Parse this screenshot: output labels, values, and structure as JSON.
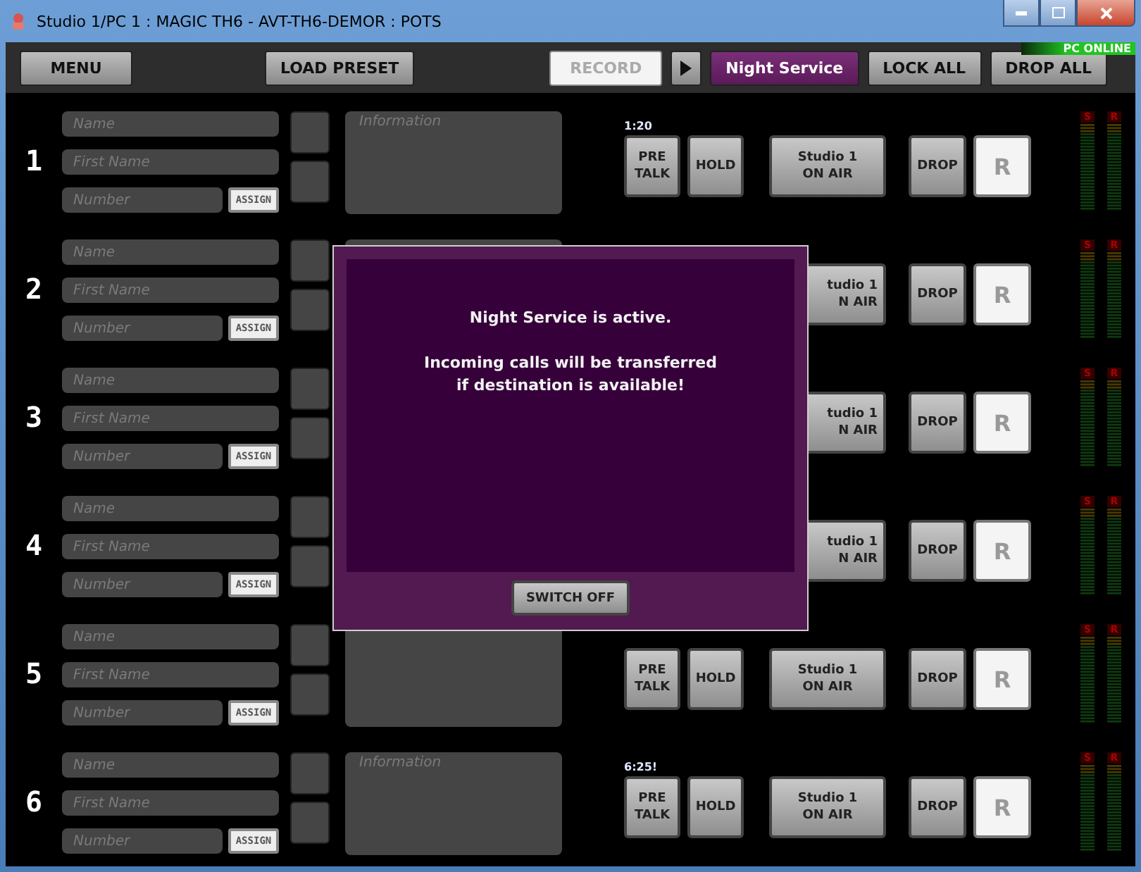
{
  "window": {
    "title": "Studio 1/PC 1 : MAGIC TH6 - AVT-TH6-DEMOR : POTS"
  },
  "toolbar": {
    "groups": [
      [
        {
          "kind": "text",
          "label": "MENU",
          "disabled": false,
          "on": false
        }
      ],
      [
        {
          "kind": "text",
          "label": "LOAD PRESET",
          "disabled": false,
          "on": false
        }
      ],
      [
        {
          "kind": "text",
          "label": "RECORD",
          "disabled": true,
          "on": false
        },
        {
          "kind": "play"
        },
        {
          "kind": "text",
          "label": "Night Service",
          "disabled": false,
          "on": true
        },
        {
          "kind": "text",
          "label": "LOCK ALL",
          "disabled": false,
          "on": false
        },
        {
          "kind": "text",
          "label": "DROP ALL",
          "disabled": false,
          "on": false
        }
      ]
    ]
  },
  "status": {
    "label": "PC ONLINE",
    "online": true
  },
  "lines": [
    {
      "kind": "full",
      "number": "1",
      "name_placeholder": "Name",
      "first_name_placeholder": "First Name",
      "number_placeholder": "Number",
      "assign": "ASSIGN",
      "info_placeholder": "Information",
      "timer": "1:20",
      "pre_talk": "PRE\nTALK",
      "hold": "HOLD",
      "on_air": "Studio 1\nON AIR",
      "drop": "DROP",
      "r": "R",
      "meter_labels": [
        "S",
        "R"
      ]
    },
    {
      "kind": "covered",
      "number": "2",
      "name_placeholder": "Name",
      "first_name_placeholder": "First Name",
      "number_placeholder": "Number",
      "assign": "ASSIGN",
      "on_air": "tudio 1\nN AIR",
      "drop": "DROP",
      "r": "R",
      "meter_labels": [
        "S",
        "R"
      ]
    },
    {
      "kind": "covered",
      "number": "3",
      "name_placeholder": "Name",
      "first_name_placeholder": "First Name",
      "number_placeholder": "Number",
      "assign": "ASSIGN",
      "on_air": "tudio 1\nN AIR",
      "drop": "DROP",
      "r": "R",
      "meter_labels": [
        "S",
        "R"
      ]
    },
    {
      "kind": "covered",
      "number": "4",
      "name_placeholder": "Name",
      "first_name_placeholder": "First Name",
      "number_placeholder": "Number",
      "assign": "ASSIGN",
      "on_air": "tudio 1\nN AIR",
      "drop": "DROP",
      "r": "R",
      "meter_labels": [
        "S",
        "R"
      ]
    },
    {
      "kind": "full",
      "number": "5",
      "name_placeholder": "Name",
      "first_name_placeholder": "First Name",
      "number_placeholder": "Number",
      "assign": "ASSIGN",
      "pre_talk": "PRE\nTALK",
      "hold": "HOLD",
      "on_air": "Studio 1\nON AIR",
      "drop": "DROP",
      "r": "R",
      "meter_labels": [
        "S",
        "R"
      ]
    },
    {
      "kind": "full",
      "number": "6",
      "name_placeholder": "Name",
      "first_name_placeholder": "First Name",
      "number_placeholder": "Number",
      "assign": "ASSIGN",
      "info_placeholder": "Information",
      "timer": "6:25!",
      "pre_talk": "PRE\nTALK",
      "hold": "HOLD",
      "on_air": "Studio 1\nON AIR",
      "drop": "DROP",
      "r": "R",
      "meter_labels": [
        "S",
        "R"
      ]
    }
  ],
  "dialog": {
    "message": "Night Service is active.",
    "detail": "Incoming calls will be transferred\nif destination is available!",
    "button": "SWITCH OFF"
  }
}
